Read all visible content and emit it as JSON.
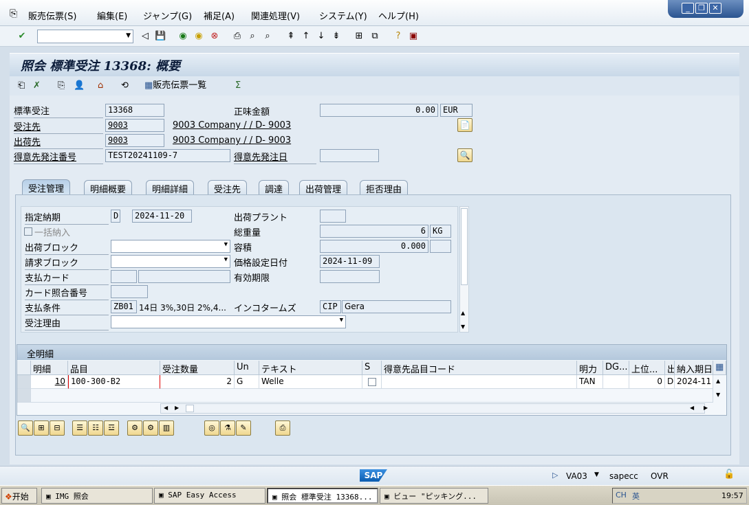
{
  "menu": [
    "販売伝票(S)",
    "編集(E)",
    "ジャンプ(G)",
    "補足(A)",
    "関連処理(V)",
    "システム(Y)",
    "ヘルプ(H)"
  ],
  "window_buttons": [
    "minimize",
    "restore",
    "close"
  ],
  "title": "照会 標準受注 13368: 概要",
  "app_toolbar": {
    "doc_list_label": "販売伝票一覧"
  },
  "header": {
    "std_order_label": "標準受注",
    "std_order_value": "13368",
    "net_value_label": "正味金額",
    "net_value": "0.00",
    "currency": "EUR",
    "sold_to_label": "受注先",
    "sold_to_value": "9003",
    "sold_to_desc": "9003 Company / / D- 9003",
    "ship_to_label": "出荷先",
    "ship_to_value": "9003",
    "ship_to_desc": "9003 Company / / D- 9003",
    "po_label": "得意先発注番号",
    "po_value": "TEST20241109-7",
    "po_date_label": "得意先発注日",
    "po_date_value": ""
  },
  "tabs": [
    "受注管理",
    "明細概要",
    "明細詳細",
    "受注先",
    "調達",
    "出荷管理",
    "拒否理由"
  ],
  "active_tab": 0,
  "sales": {
    "req_date_label": "指定納期",
    "req_date_type": "D",
    "req_date": "2024-11-20",
    "complete_dlv_label": "一括納入",
    "dlv_block_label": "出荷ブロック",
    "billing_block_label": "請求ブロック",
    "pay_card_label": "支払カード",
    "card_verif_label": "カード照合番号",
    "pay_terms_label": "支払条件",
    "pay_terms_code": "ZB01",
    "pay_terms_desc": "14日 3%,30日 2%,4...",
    "order_reason_label": "受注理由",
    "plant_label": "出荷プラント",
    "plant_value": "",
    "weight_label": "総重量",
    "weight_value": "6",
    "weight_unit": "KG",
    "volume_label": "容積",
    "volume_value": "0.000",
    "volume_unit": "",
    "pricing_date_label": "価格設定日付",
    "pricing_date": "2024-11-09",
    "valid_to_label": "有効期限",
    "valid_to": "",
    "incoterms_label": "インコタームズ",
    "incoterms_code": "CIP",
    "incoterms_place": "Gera"
  },
  "items": {
    "title": "全明細",
    "columns": [
      "明細",
      "品目",
      "受注数量",
      "Un",
      "テキスト",
      "S",
      "得意先品目コード",
      "明力",
      "DG...",
      "上位...",
      "出",
      "納入期日"
    ],
    "rows": [
      {
        "item": "10",
        "material": "100-300-B2",
        "qty": "2",
        "unit": "G",
        "text": "Welle",
        "cust_mat": "",
        "category": "TAN",
        "dg": "",
        "higher": "0",
        "d": "D",
        "delivery_date": "2024-11"
      }
    ]
  },
  "status": {
    "tcode": "VA03",
    "system": "sapecc",
    "mode": "OVR"
  },
  "taskbar": {
    "start": "开始",
    "tasks": [
      "IMG 照会",
      "SAP Easy Access",
      "照会 標準受注 13368...",
      "ビュー \"ピッキング..."
    ],
    "active_task": 2,
    "clock": "19:57"
  },
  "colors": {
    "accent": "#2a5490",
    "sap_logo": "#0a6ed1"
  }
}
